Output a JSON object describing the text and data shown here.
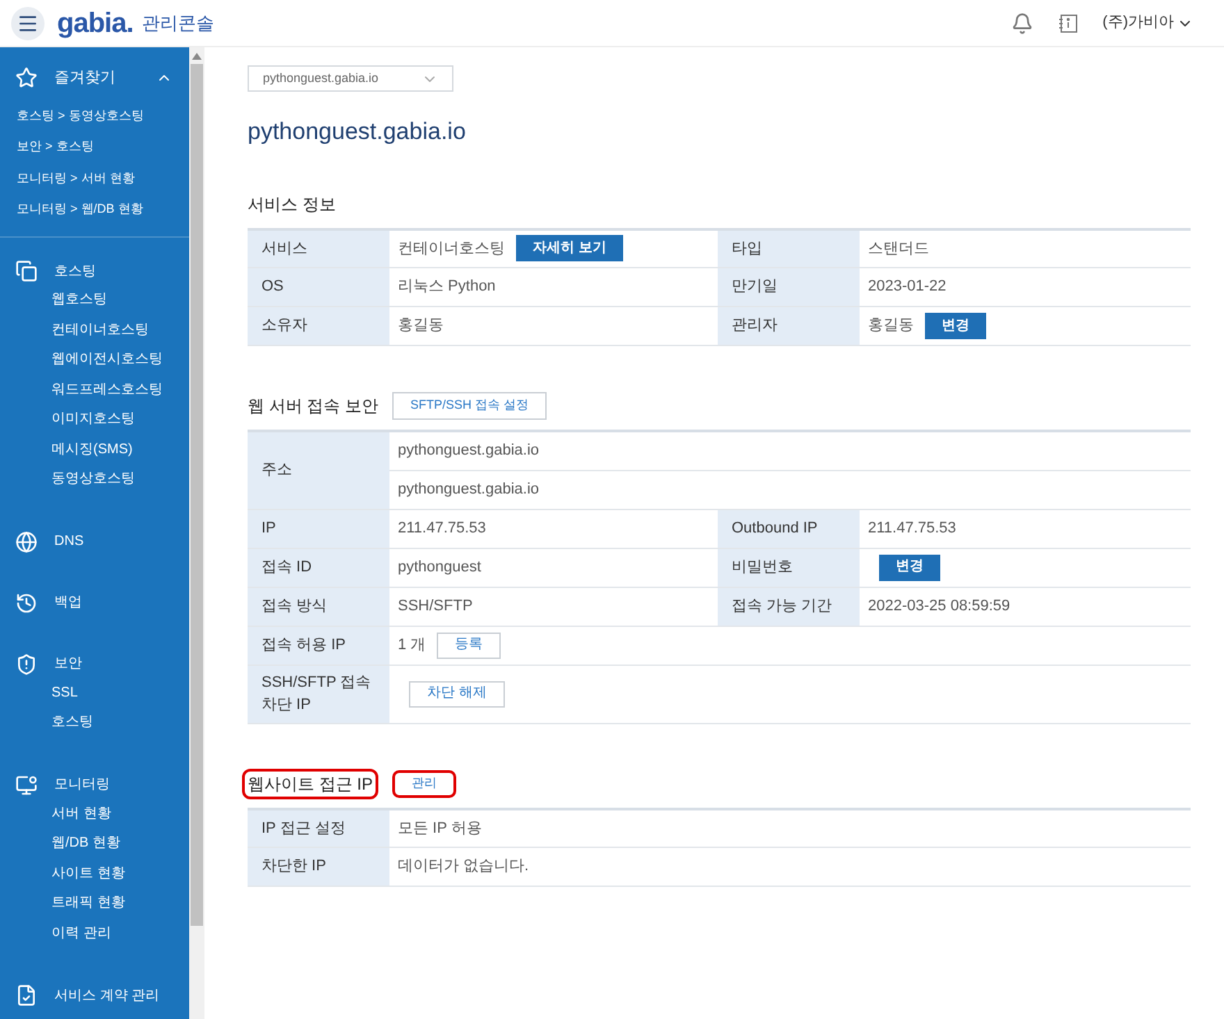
{
  "header": {
    "logo": "gabia.",
    "title": "관리콘솔",
    "company": "(주)가비아"
  },
  "sidebar": {
    "favorites": {
      "label": "즐겨찾기",
      "expanded": true,
      "items": [
        "호스팅 > 동영상호스팅",
        "보안 > 호스팅",
        "모니터링 > 서버 현황",
        "모니터링 > 웹/DB 현황"
      ]
    },
    "groups": [
      {
        "label": "호스팅",
        "items": [
          "웹호스팅",
          "컨테이너호스팅",
          "웹에이전시호스팅",
          "워드프레스호스팅",
          "이미지호스팅",
          "메시징(SMS)",
          "동영상호스팅"
        ]
      },
      {
        "label": "DNS"
      },
      {
        "label": "백업"
      },
      {
        "label": "보안",
        "items": [
          "SSL",
          "호스팅"
        ]
      },
      {
        "label": "모니터링",
        "items": [
          "서버 현황",
          "웹/DB 현황",
          "사이트 현황",
          "트래픽 현황",
          "이력 관리"
        ]
      },
      {
        "label": "서비스 계약 관리"
      }
    ]
  },
  "domain_select": {
    "value": "pythonguest.gabia.io"
  },
  "page_title": "pythonguest.gabia.io",
  "sections": [
    {
      "title": "서비스 정보",
      "highlighted": false,
      "rows": [
        [
          {
            "kind": "label",
            "text": "서비스"
          },
          {
            "kind": "value",
            "text": "컨테이너호스팅",
            "button": {
              "kind": "filled",
              "label": "자세히 보기"
            }
          },
          {
            "kind": "label",
            "text": "타입"
          },
          {
            "kind": "value",
            "text": "스탠더드"
          }
        ],
        [
          {
            "kind": "label",
            "text": "OS"
          },
          {
            "kind": "value",
            "text": "리눅스 Python"
          },
          {
            "kind": "label",
            "text": "만기일"
          },
          {
            "kind": "value",
            "text": "2023-01-22"
          }
        ],
        [
          {
            "kind": "label",
            "text": "소유자"
          },
          {
            "kind": "value",
            "text": "홍길동"
          },
          {
            "kind": "label",
            "text": "관리자"
          },
          {
            "kind": "value",
            "text": "홍길동",
            "button": {
              "kind": "filled",
              "label": "변경"
            }
          }
        ]
      ]
    },
    {
      "title": "웹 서버 접속 보안",
      "highlighted": false,
      "button": {
        "label": "SFTP/SSH 접속 설정",
        "highlighted": false
      },
      "rows": [
        [
          {
            "kind": "label",
            "text": "주소",
            "rowspan": 2
          },
          {
            "kind": "value",
            "text": "pythonguest.gabia.io",
            "colspan": 3
          }
        ],
        [
          {
            "kind": "value",
            "text": "pythonguest.gabia.io",
            "colspan": 3
          }
        ],
        [
          {
            "kind": "label",
            "text": "IP"
          },
          {
            "kind": "value",
            "text": "211.47.75.53"
          },
          {
            "kind": "label",
            "text": "Outbound IP"
          },
          {
            "kind": "value",
            "text": "211.47.75.53"
          }
        ],
        [
          {
            "kind": "label",
            "text": "접속 ID"
          },
          {
            "kind": "value",
            "text": "pythonguest"
          },
          {
            "kind": "label",
            "text": "비밀번호"
          },
          {
            "kind": "value",
            "button": {
              "kind": "filled",
              "label": "변경"
            }
          }
        ],
        [
          {
            "kind": "label",
            "text": "접속 방식"
          },
          {
            "kind": "value",
            "text": "SSH/SFTP"
          },
          {
            "kind": "label",
            "text": "접속 가능 기간"
          },
          {
            "kind": "value",
            "text": "2022-03-25 08:59:59"
          }
        ],
        [
          {
            "kind": "label",
            "text": "접속 허용 IP"
          },
          {
            "kind": "value",
            "text": "1 개",
            "button": {
              "kind": "outline",
              "label": "등록"
            },
            "colspan": 3
          }
        ],
        [
          {
            "kind": "label",
            "text": "SSH/SFTP 접속 차단 IP"
          },
          {
            "kind": "value",
            "button": {
              "kind": "outline",
              "label": "차단 해제"
            },
            "colspan": 3
          }
        ]
      ]
    },
    {
      "title": "웹사이트 접근 IP",
      "highlighted": true,
      "button": {
        "label": "관리",
        "highlighted": true
      },
      "rows": [
        [
          {
            "kind": "label",
            "text": "IP 접근 설정"
          },
          {
            "kind": "value",
            "text": "모든 IP 허용",
            "colspan": 3
          }
        ],
        [
          {
            "kind": "label",
            "text": "차단한 IP"
          },
          {
            "kind": "value",
            "text": "데이터가 없습니다.",
            "colspan": 3
          }
        ]
      ]
    }
  ]
}
